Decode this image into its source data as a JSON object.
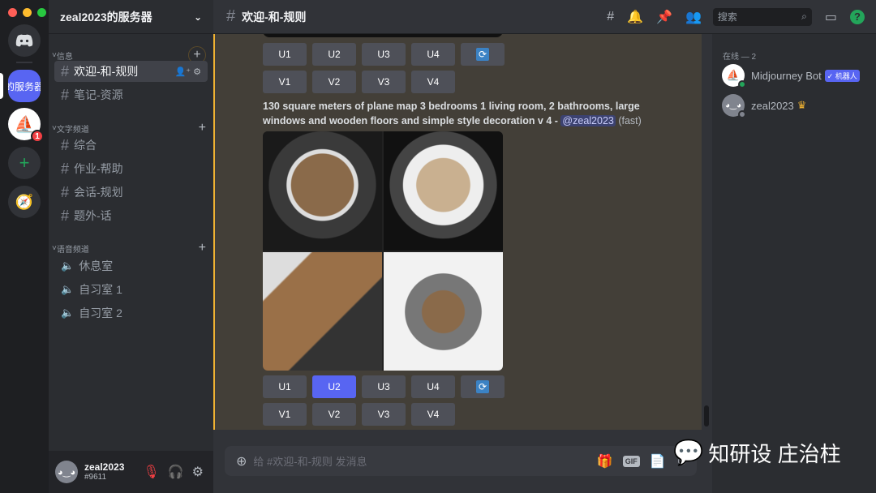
{
  "window": {
    "traffic_lights": [
      "#ff5f57",
      "#febc2e",
      "#28c840"
    ]
  },
  "servers": {
    "home_label": "Discord",
    "current_label": "的服务器",
    "mj_badge": "1"
  },
  "sidebar": {
    "server_name": "zeal2023的服务器",
    "categories": [
      {
        "label": "信息"
      },
      {
        "label": "文字频道"
      },
      {
        "label": "语音频道"
      }
    ],
    "info_channels": [
      {
        "label": "欢迎-和-规则"
      },
      {
        "label": "笔记-资源"
      }
    ],
    "text_channels": [
      {
        "label": "综合"
      },
      {
        "label": "作业-帮助"
      },
      {
        "label": "会话-规划"
      },
      {
        "label": "题外-话"
      }
    ],
    "voice_channels": [
      {
        "label": "休息室"
      },
      {
        "label": "自习室 1"
      },
      {
        "label": "自习室 2"
      }
    ]
  },
  "user": {
    "name": "zeal2023",
    "tag": "#9611"
  },
  "header": {
    "channel": "欢迎-和-规则",
    "search_placeholder": "搜索"
  },
  "message": {
    "prompt": "130 square meters of plane map 3 bedrooms 1 living room, 2 bathrooms, large windows and wooden floors and simple style decoration v 4 - ",
    "mention": "@zeal2023",
    "speed": "(fast)",
    "upscale": [
      "U1",
      "U2",
      "U3",
      "U4"
    ],
    "variation": [
      "V1",
      "V2",
      "V3",
      "V4"
    ],
    "selected": "U2",
    "accent": "#5865f2"
  },
  "composer": {
    "placeholder": "给 #欢迎-和-规则 发消息",
    "gif": "GIF"
  },
  "members": {
    "heading": "在线 — 2",
    "list": [
      {
        "name": "Midjourney Bot",
        "badge": "✓ 机器人"
      },
      {
        "name": "zeal2023"
      }
    ]
  },
  "watermark": "知研设 庄治柱"
}
